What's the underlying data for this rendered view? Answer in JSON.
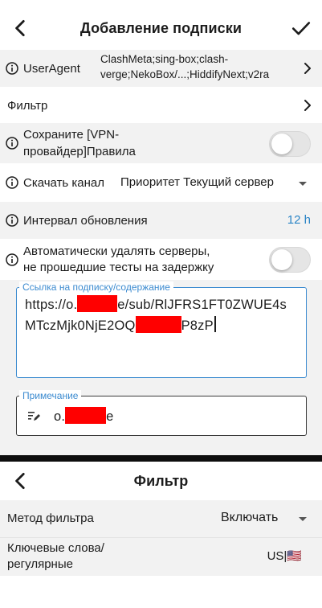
{
  "screen1": {
    "title": "Добавление подписки",
    "user_agent": {
      "label": "UserAgent",
      "value_line1": "ClashMeta;sing-box;clash-",
      "value_line2": "verge;NekoBox/...;HiddifyNext;v2ra"
    },
    "filter": {
      "label": "Фильтр"
    },
    "save_rules": {
      "label_line1": "Сохраните [VPN-",
      "label_line2": "провайдер]Правила",
      "enabled": false
    },
    "download_channel": {
      "label": "Скачать канал",
      "value": "Приоритет Текущий сервер"
    },
    "update_interval": {
      "label": "Интервал обновления",
      "value": "12 h"
    },
    "auto_delete": {
      "label_line1": "Автоматически удалять серверы,",
      "label_line2": "не прошедшие тесты на задержку",
      "enabled": false
    },
    "link_field": {
      "legend": "Ссылка на подписку/содержание",
      "line1_a": "https://o.",
      "line1_b": "e/sub/RlJFRS1FT0ZWUE4s",
      "line2_a": "MTczMjk0NjE2OQ",
      "line2_b": "P8zP"
    },
    "note_field": {
      "legend": "Примечание",
      "value_a": "o.",
      "value_b": "e"
    }
  },
  "screen2": {
    "title": "Фильтр",
    "method": {
      "label": "Метод фильтра",
      "value": "Включать"
    },
    "keywords": {
      "label_line1": "Ключевые слова/",
      "label_line2": "регулярные",
      "value": "US|🇺🇸"
    }
  },
  "colors": {
    "accent": "#3c8bd0",
    "value_blue": "#2a84c6",
    "redaction": "#ff0000"
  }
}
